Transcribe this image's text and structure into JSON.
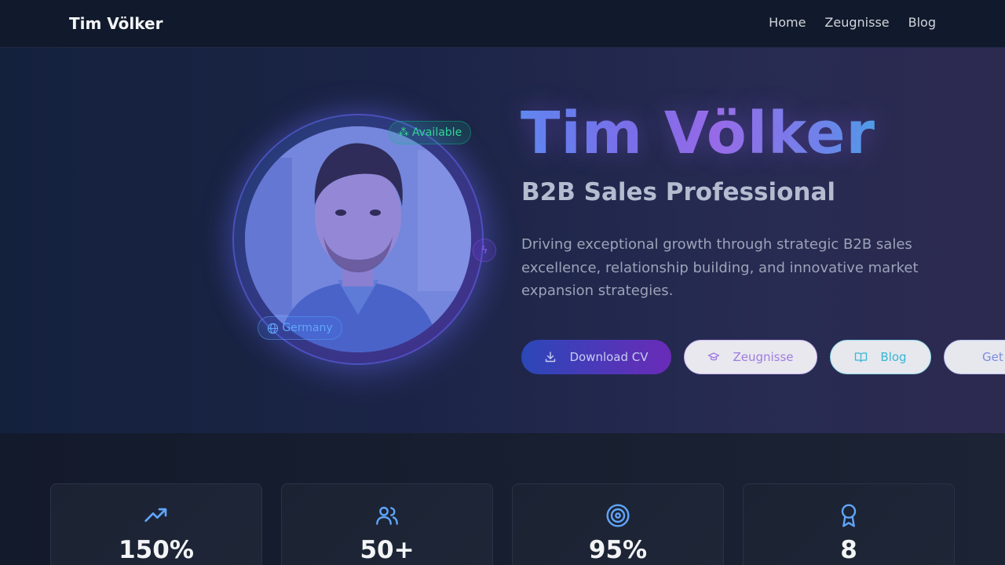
{
  "nav": {
    "brand": "Tim Völker",
    "links": [
      "Home",
      "Zeugnisse",
      "Blog"
    ]
  },
  "hero": {
    "title": "Tim Völker",
    "subtitle": "B2B Sales Professional",
    "description": "Driving exceptional growth through strategic B2B sales excellence, relationship building, and innovative market expansion strategies.",
    "badge_available": "Available",
    "badge_location": "Germany",
    "buttons": {
      "download_cv": "Download CV",
      "zeugnisse": "Zeugnisse",
      "blog": "Blog",
      "contact": "Get in Touch"
    }
  },
  "stats": [
    {
      "icon": "trending-up-icon",
      "value": "150%"
    },
    {
      "icon": "users-icon",
      "value": "50+"
    },
    {
      "icon": "target-icon",
      "value": "95%"
    },
    {
      "icon": "award-icon",
      "value": "8"
    }
  ],
  "colors": {
    "accent_blue": "#3b82f6",
    "accent_purple": "#7c3aed",
    "available_green": "#34d399",
    "stat_icon": "#60a5fa"
  }
}
